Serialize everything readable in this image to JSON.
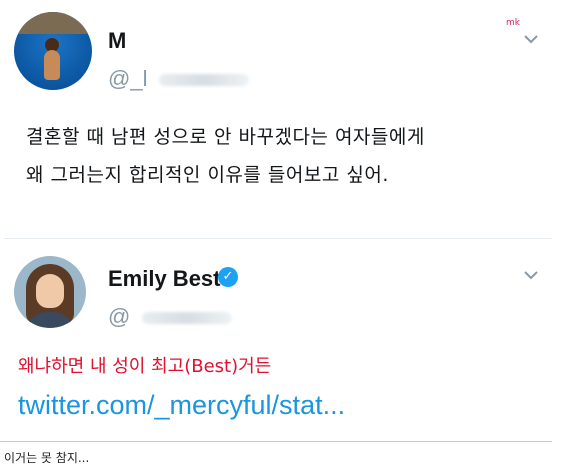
{
  "tweet1": {
    "name": "M",
    "handle": "@_l",
    "lines": [
      "결혼할 때 남편 성으로 안 바꾸겠다는 여자들에게",
      "왜 그러는지 합리적인 이유를 들어보고 싶어."
    ],
    "watermark": "mk"
  },
  "tweet2": {
    "name": "Emily Best",
    "handle": "@",
    "reply": "왜냐하면 내 성이 최고(Best)거든",
    "link": "twitter.com/_mercyful/stat..."
  },
  "caption": "이거는 못 참지...",
  "icons": {
    "verified": "verified-badge-icon",
    "chevron": "chevron-down-icon"
  },
  "colors": {
    "link": "#1b95e0",
    "reply_text": "#e0102f",
    "verified": "#1da1f2",
    "muted": "#8899a6"
  }
}
